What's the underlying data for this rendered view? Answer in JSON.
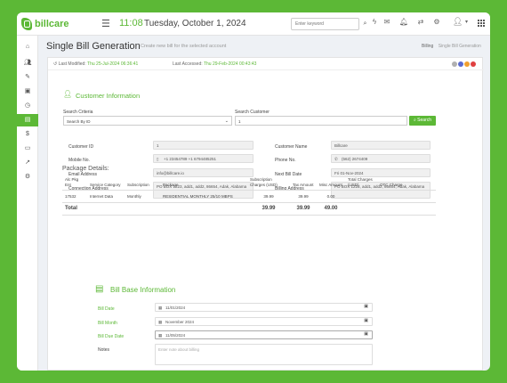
{
  "app": {
    "logo_text": "billcare",
    "clock": "11:08",
    "date": "Tuesday, October 1, 2024"
  },
  "topbar": {
    "search_placeholder": "Enter keyword",
    "icons": [
      "hamburger-icon",
      "search-icon",
      "bolt-icon",
      "mail-icon",
      "bell-icon",
      "refresh-icon",
      "gear-icon",
      "user-icon",
      "apps-icon"
    ]
  },
  "sidebar": {
    "icons": [
      "home-icon",
      "people-icon",
      "tools-icon",
      "box-icon",
      "clock-icon",
      "bill-icon",
      "money-icon",
      "monitor-icon",
      "chart-icon",
      "settings-icon"
    ],
    "active_index": 5
  },
  "page": {
    "title": "Single Bill Generation",
    "subtitle": "Create new bill for the selected account",
    "breadcrumb": [
      "Billing",
      "Single Bill Generation"
    ]
  },
  "meta": {
    "last_modified_label": "Last Modified:",
    "last_modified_value": "Thu 25-Jul-2024 06:36:41",
    "last_accessed_label": "Last Accessed:",
    "last_accessed_value": "Thu 29-Feb-2024 00:43:43",
    "dot_colors": [
      "#b0b0b0",
      "#5a6acf",
      "#f0a030",
      "#e04040"
    ]
  },
  "customer": {
    "section_title": "Customer Information",
    "search_criteria_label": "Search Criteria",
    "search_criteria_value": "Search By ID",
    "search_customer_label": "Search Customer",
    "search_customer_value": "1",
    "search_button": "Search",
    "fields_left": [
      {
        "label": "Customer ID",
        "value": "1",
        "icon": ""
      },
      {
        "label": "Mobile No.",
        "value": "+1 23454789 +1 6794485251",
        "icon": "mobile-icon"
      },
      {
        "label": "Email Address",
        "value": "info@billcare.io",
        "icon": ""
      },
      {
        "label": "Connection Address",
        "value": "PO BOX 1223, add1, add2, 86654, Adak, Alabama",
        "icon": ""
      }
    ],
    "fields_right": [
      {
        "label": "Customer Name",
        "value": "Billcare",
        "icon": ""
      },
      {
        "label": "Phone No.",
        "value": "(562) 2674409",
        "icon": "phone-icon"
      },
      {
        "label": "Next Bill Date",
        "value": "Fri 01-Nov-2024",
        "icon": ""
      },
      {
        "label": "Billing Address",
        "value": "PO BOX 1223, add1, add2, 86654, Adak, Alabama",
        "icon": ""
      }
    ]
  },
  "package": {
    "title": "Package Details:",
    "headers": [
      "Alc Pkg Ent",
      "Service Category",
      "Subscription",
      "Package",
      "Subscription Charges (USD)",
      "Tax Amount",
      "Misc Amount",
      "Total Charges (USD)",
      "OTC Charge"
    ],
    "rows": [
      [
        "17532",
        "Internet Data",
        "Monthly",
        "RESIDENTIAL MONTHLY 25/10 MBPS",
        "39.99",
        "39.99",
        "0.00",
        "",
        ""
      ]
    ],
    "total_label": "Total",
    "totals": [
      "39.99",
      "39.99",
      "49.00"
    ]
  },
  "billbase": {
    "section_title": "Bill Base Information",
    "bill_date_label": "Bill Date",
    "bill_date_value": "11/01/2024",
    "bill_month_label": "Bill Month",
    "bill_month_value": "November 2024",
    "bill_due_label": "Bill Due Date",
    "bill_due_value": "11/05/2024",
    "notes_label": "Notes",
    "notes_placeholder": "Enter note about billing"
  }
}
